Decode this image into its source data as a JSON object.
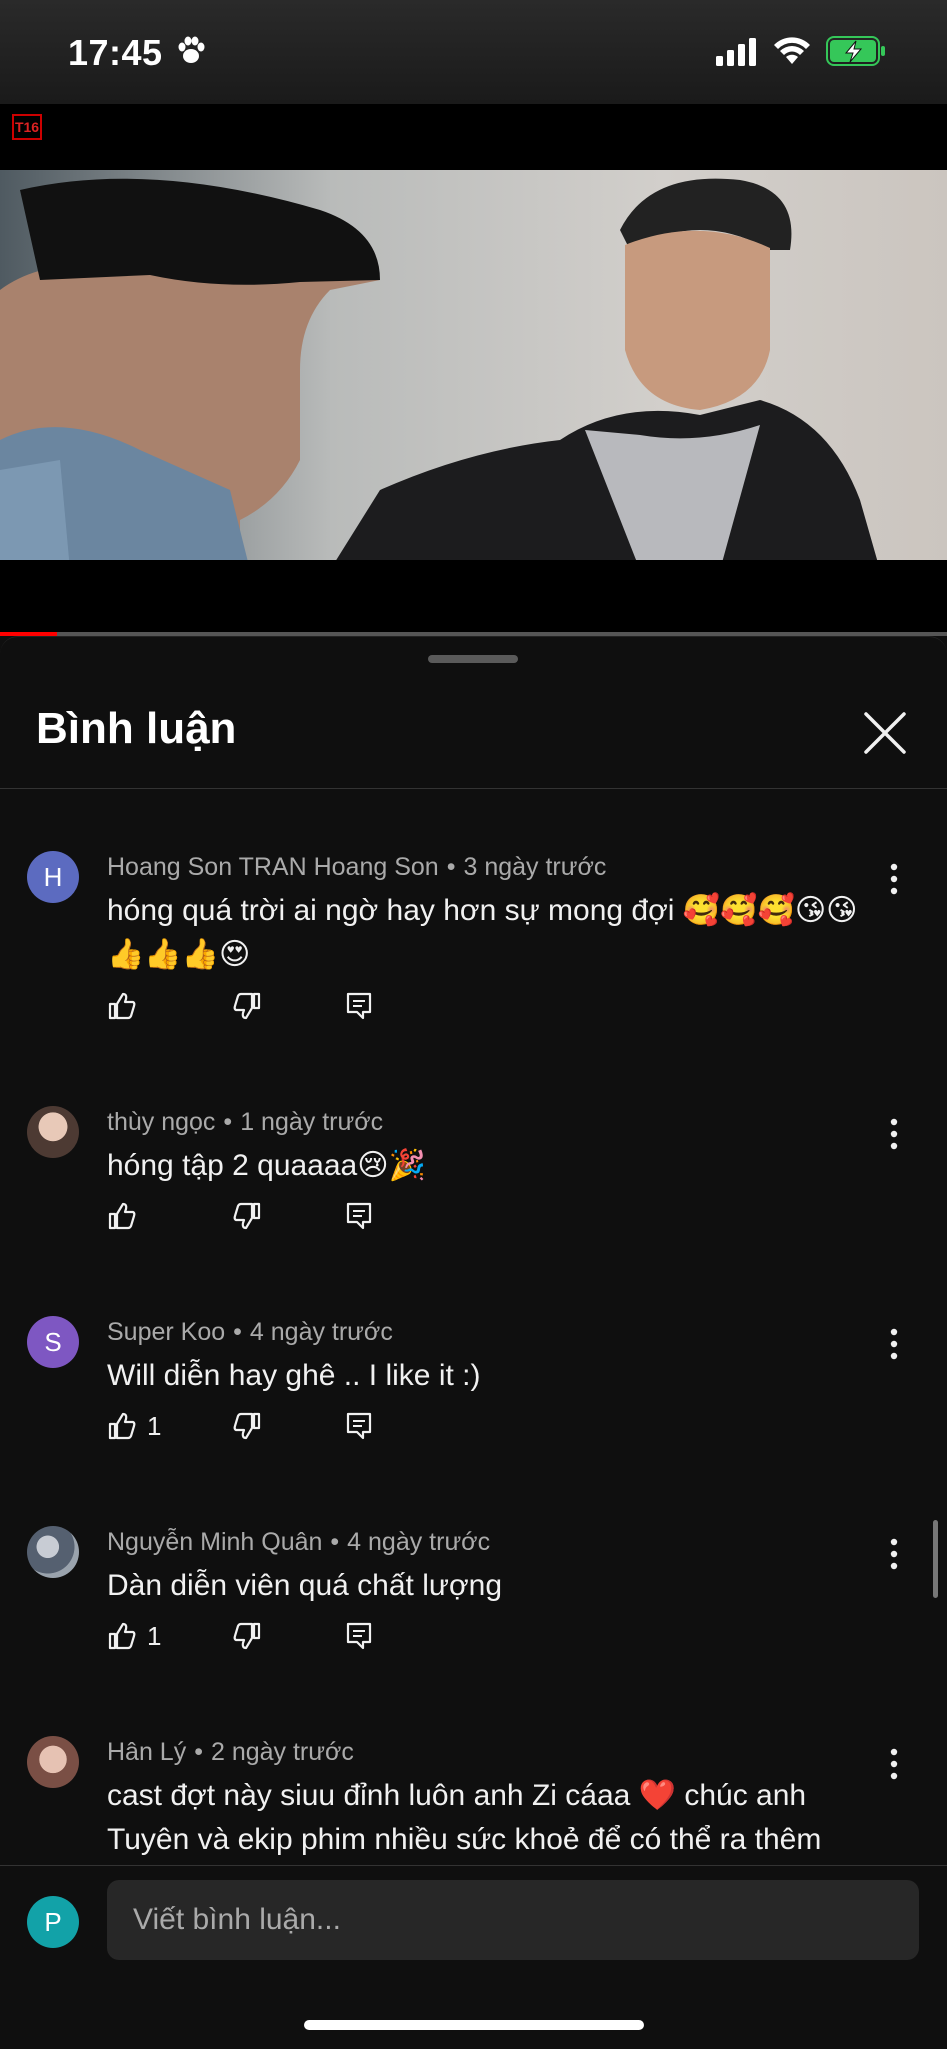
{
  "status_bar": {
    "time": "17:45"
  },
  "video": {
    "rating": "T16",
    "progress": 0.06
  },
  "sheet": {
    "title": "Bình luận"
  },
  "comments": [
    {
      "avatar_letter": "H",
      "avatar_color": "#5c6bc0",
      "author": "Hoang Son TRAN Hoang Son",
      "time": "3 ngày trước",
      "text": "hóng quá trời ai ngờ hay hơn sự mong đợi 🥰🥰🥰😘😘👍👍👍😍",
      "likes": ""
    },
    {
      "avatar_letter": "",
      "avatar_color": "#c9a48f",
      "author": "thùy ngọc",
      "time": "1 ngày trước",
      "text": "hóng tập 2 quaaaa😢🎉",
      "likes": ""
    },
    {
      "avatar_letter": "S",
      "avatar_color": "#7e57c2",
      "author": "Super Koo",
      "time": "4 ngày trước",
      "text": "Will diễn hay ghê .. I like it :)",
      "likes": "1"
    },
    {
      "avatar_letter": "",
      "avatar_color": "#7f8a99",
      "author": "Nguyễn Minh Quân",
      "time": "4 ngày trước",
      "text": "Dàn diễn viên quá chất lượng",
      "likes": "1"
    },
    {
      "avatar_letter": "",
      "avatar_color": "#b38a84",
      "author": "Hân Lý",
      "time": "2 ngày trước",
      "text": "cast đợt này siuu đỉnh luôn anh Zi cáaa ❤️ chúc anh Tuyên và ekip phim nhiều sức khoẻ để có thể ra thêm",
      "likes": ""
    }
  ],
  "input": {
    "avatar_letter": "P",
    "placeholder": "Viết bình luận..."
  },
  "icons": [
    "paw-icon",
    "signal-icon",
    "wifi-icon",
    "battery-charging-icon",
    "close-icon",
    "more-vert-icon",
    "like-icon",
    "dislike-icon",
    "reply-icon"
  ]
}
